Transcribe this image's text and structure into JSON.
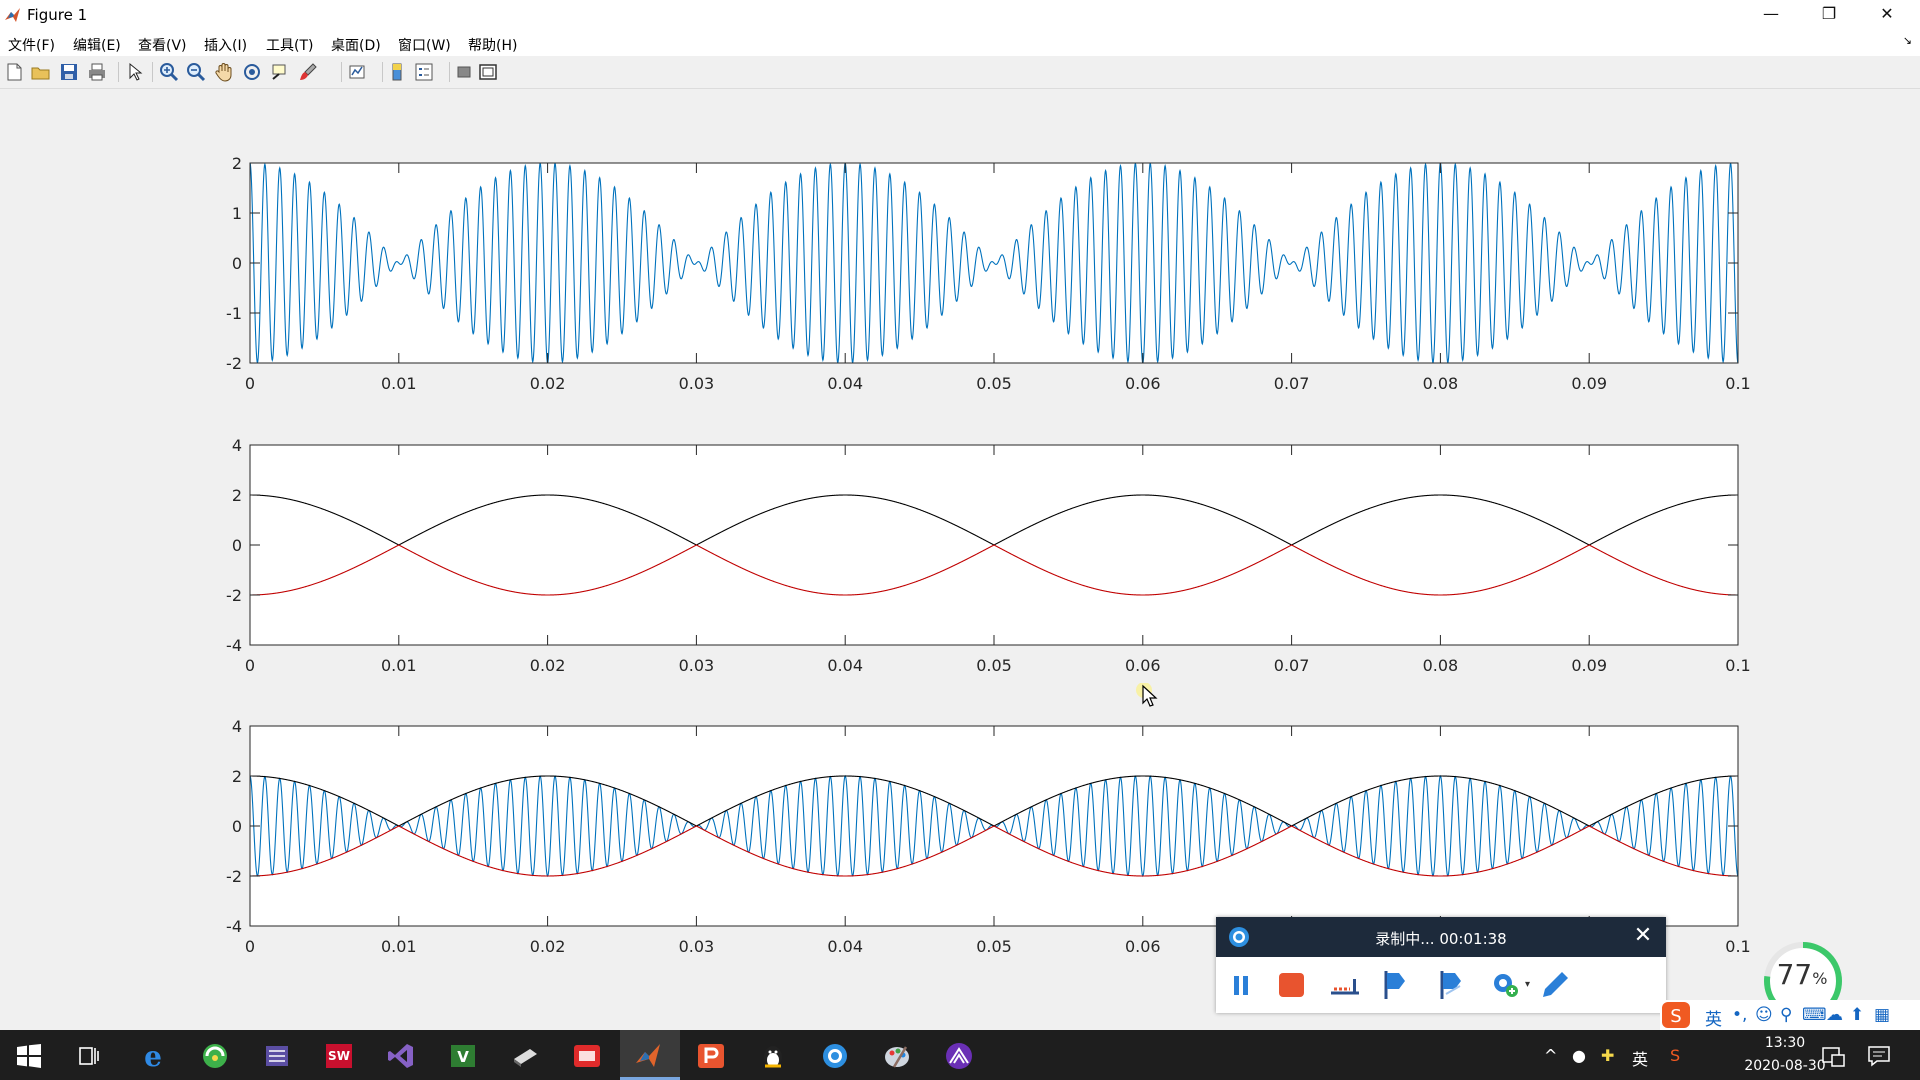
{
  "window": {
    "title": "Figure 1",
    "minimize": "—",
    "restore": "❐",
    "close": "✕"
  },
  "menu": [
    {
      "label": "文件(F)"
    },
    {
      "label": "编辑(E)"
    },
    {
      "label": "查看(V)"
    },
    {
      "label": "插入(I)"
    },
    {
      "label": "工具(T)"
    },
    {
      "label": "桌面(D)"
    },
    {
      "label": "窗口(W)"
    },
    {
      "label": "帮助(H)"
    }
  ],
  "menu_arrow": "↘",
  "toolbar": [
    {
      "icon": "new-figure-icon"
    },
    {
      "icon": "open-file-icon"
    },
    {
      "icon": "save-icon"
    },
    {
      "icon": "print-icon"
    },
    {
      "icon": "select-arrow-icon"
    },
    {
      "icon": "zoom-in-icon"
    },
    {
      "icon": "zoom-out-icon"
    },
    {
      "icon": "pan-hand-icon"
    },
    {
      "icon": "rotate-3d-icon"
    },
    {
      "icon": "data-cursor-icon"
    },
    {
      "icon": "brush-icon"
    },
    {
      "icon": "link-plot-icon"
    },
    {
      "icon": "colorbar-icon"
    },
    {
      "icon": "legend-icon"
    },
    {
      "icon": "hide-plot-tools-icon"
    },
    {
      "icon": "show-plot-tools-icon"
    }
  ],
  "chart_data": [
    {
      "type": "line",
      "title": "",
      "xlabel": "",
      "ylabel": "",
      "xlim": [
        0,
        0.1
      ],
      "ylim": [
        -2,
        2
      ],
      "xticks": [
        "0",
        "0.01",
        "0.02",
        "0.03",
        "0.04",
        "0.05",
        "0.06",
        "0.07",
        "0.08",
        "0.09",
        "0.1"
      ],
      "yticks": [
        "2",
        "1",
        "0",
        "-1",
        "-2"
      ],
      "ytick_values": [
        2,
        1,
        0,
        -1,
        -2
      ],
      "series": [
        {
          "color": "#0072bd",
          "formula": "2*cos(2*pi*25*t)*cos(2*pi*1000*t)",
          "envelope_hz": 25,
          "carrier_hz": 1000,
          "amplitude": 2
        }
      ]
    },
    {
      "type": "line",
      "title": "",
      "xlabel": "",
      "ylabel": "",
      "xlim": [
        0,
        0.1
      ],
      "ylim": [
        -4,
        4
      ],
      "xticks": [
        "0",
        "0.01",
        "0.02",
        "0.03",
        "0.04",
        "0.05",
        "0.06",
        "0.07",
        "0.08",
        "0.09",
        "0.1"
      ],
      "yticks": [
        "4",
        "2",
        "0",
        "-2",
        "-4"
      ],
      "ytick_values": [
        4,
        2,
        0,
        -2,
        -4
      ],
      "series": [
        {
          "color": "#000000",
          "formula": "|2*cos(2*pi*25*t)|",
          "envelope_hz": 25,
          "amplitude": 2
        },
        {
          "color": "#c00000",
          "formula": "-|2*cos(2*pi*25*t)|",
          "envelope_hz": 25,
          "amplitude": -2
        }
      ]
    },
    {
      "type": "line",
      "title": "",
      "xlabel": "",
      "ylabel": "",
      "xlim": [
        0,
        0.1
      ],
      "ylim": [
        -4,
        4
      ],
      "xticks": [
        "0",
        "0.01",
        "0.02",
        "0.03",
        "0.04",
        "0.05",
        "0.06",
        "0.07",
        "0.08",
        "0.09",
        "0.1"
      ],
      "yticks": [
        "4",
        "2",
        "0",
        "-2",
        "-4"
      ],
      "ytick_values": [
        4,
        2,
        0,
        -2,
        -4
      ],
      "series": [
        {
          "color": "#0072bd",
          "formula": "2*cos(2*pi*25*t)*cos(2*pi*1000*t)",
          "envelope_hz": 25,
          "carrier_hz": 1000,
          "amplitude": 2
        },
        {
          "color": "#000000",
          "formula": "|2*cos(2*pi*25*t)|",
          "envelope_hz": 25,
          "amplitude": 2
        },
        {
          "color": "#c00000",
          "formula": "-|2*cos(2*pi*25*t)|",
          "envelope_hz": 25,
          "amplitude": -2
        }
      ]
    }
  ],
  "recorder": {
    "status": "录制中... 00:01:38",
    "close": "✕"
  },
  "gauge": {
    "value": "77",
    "unit": "%"
  },
  "ime": {
    "lang": "英"
  },
  "tray": {
    "lang": "英",
    "up_arrow": "^"
  },
  "clock": {
    "time": "13:30",
    "date": "2020-08-30"
  },
  "colors": {
    "accent": "#0072bd",
    "upper_envelope": "#000000",
    "lower_envelope": "#c00000",
    "recorder_head": "#1d2a3b"
  }
}
